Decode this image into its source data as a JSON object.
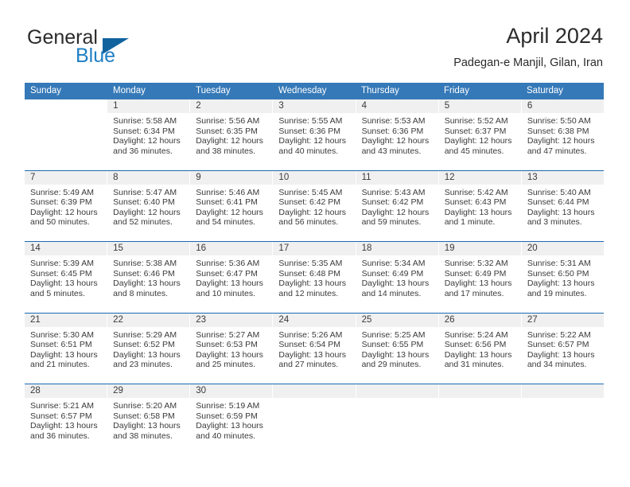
{
  "brand": {
    "name_part1": "General",
    "name_part2": "Blue",
    "logo_icon": "triangle-logo-icon"
  },
  "header": {
    "title": "April 2024",
    "subtitle": "Padegan-e Manjil, Gilan, Iran"
  },
  "colors": {
    "header_blue": "#3579b8",
    "row_separator_blue": "#1b6ab0",
    "date_band_gray": "#f0f0f0",
    "brand_blue": "#1f7fc4",
    "logo_blue": "#11639e",
    "text": "#3a3a3a"
  },
  "weekdays": [
    "Sunday",
    "Monday",
    "Tuesday",
    "Wednesday",
    "Thursday",
    "Friday",
    "Saturday"
  ],
  "labels": {
    "sunrise_prefix": "Sunrise:",
    "sunset_prefix": "Sunset:",
    "daylight_prefix": "Daylight:"
  },
  "weeks": [
    [
      {
        "day": "",
        "empty": true,
        "banded": false,
        "sunrise": "",
        "sunset": "",
        "daylight": ""
      },
      {
        "day": "1",
        "empty": false,
        "banded": true,
        "sunrise": "Sunrise: 5:58 AM",
        "sunset": "Sunset: 6:34 PM",
        "daylight": "Daylight: 12 hours and 36 minutes."
      },
      {
        "day": "2",
        "empty": false,
        "banded": true,
        "sunrise": "Sunrise: 5:56 AM",
        "sunset": "Sunset: 6:35 PM",
        "daylight": "Daylight: 12 hours and 38 minutes."
      },
      {
        "day": "3",
        "empty": false,
        "banded": true,
        "sunrise": "Sunrise: 5:55 AM",
        "sunset": "Sunset: 6:36 PM",
        "daylight": "Daylight: 12 hours and 40 minutes."
      },
      {
        "day": "4",
        "empty": false,
        "banded": true,
        "sunrise": "Sunrise: 5:53 AM",
        "sunset": "Sunset: 6:36 PM",
        "daylight": "Daylight: 12 hours and 43 minutes."
      },
      {
        "day": "5",
        "empty": false,
        "banded": true,
        "sunrise": "Sunrise: 5:52 AM",
        "sunset": "Sunset: 6:37 PM",
        "daylight": "Daylight: 12 hours and 45 minutes."
      },
      {
        "day": "6",
        "empty": false,
        "banded": true,
        "sunrise": "Sunrise: 5:50 AM",
        "sunset": "Sunset: 6:38 PM",
        "daylight": "Daylight: 12 hours and 47 minutes."
      }
    ],
    [
      {
        "day": "7",
        "empty": false,
        "banded": true,
        "sunrise": "Sunrise: 5:49 AM",
        "sunset": "Sunset: 6:39 PM",
        "daylight": "Daylight: 12 hours and 50 minutes."
      },
      {
        "day": "8",
        "empty": false,
        "banded": true,
        "sunrise": "Sunrise: 5:47 AM",
        "sunset": "Sunset: 6:40 PM",
        "daylight": "Daylight: 12 hours and 52 minutes."
      },
      {
        "day": "9",
        "empty": false,
        "banded": true,
        "sunrise": "Sunrise: 5:46 AM",
        "sunset": "Sunset: 6:41 PM",
        "daylight": "Daylight: 12 hours and 54 minutes."
      },
      {
        "day": "10",
        "empty": false,
        "banded": true,
        "sunrise": "Sunrise: 5:45 AM",
        "sunset": "Sunset: 6:42 PM",
        "daylight": "Daylight: 12 hours and 56 minutes."
      },
      {
        "day": "11",
        "empty": false,
        "banded": true,
        "sunrise": "Sunrise: 5:43 AM",
        "sunset": "Sunset: 6:42 PM",
        "daylight": "Daylight: 12 hours and 59 minutes."
      },
      {
        "day": "12",
        "empty": false,
        "banded": true,
        "sunrise": "Sunrise: 5:42 AM",
        "sunset": "Sunset: 6:43 PM",
        "daylight": "Daylight: 13 hours and 1 minute."
      },
      {
        "day": "13",
        "empty": false,
        "banded": true,
        "sunrise": "Sunrise: 5:40 AM",
        "sunset": "Sunset: 6:44 PM",
        "daylight": "Daylight: 13 hours and 3 minutes."
      }
    ],
    [
      {
        "day": "14",
        "empty": false,
        "banded": true,
        "sunrise": "Sunrise: 5:39 AM",
        "sunset": "Sunset: 6:45 PM",
        "daylight": "Daylight: 13 hours and 5 minutes."
      },
      {
        "day": "15",
        "empty": false,
        "banded": true,
        "sunrise": "Sunrise: 5:38 AM",
        "sunset": "Sunset: 6:46 PM",
        "daylight": "Daylight: 13 hours and 8 minutes."
      },
      {
        "day": "16",
        "empty": false,
        "banded": true,
        "sunrise": "Sunrise: 5:36 AM",
        "sunset": "Sunset: 6:47 PM",
        "daylight": "Daylight: 13 hours and 10 minutes."
      },
      {
        "day": "17",
        "empty": false,
        "banded": true,
        "sunrise": "Sunrise: 5:35 AM",
        "sunset": "Sunset: 6:48 PM",
        "daylight": "Daylight: 13 hours and 12 minutes."
      },
      {
        "day": "18",
        "empty": false,
        "banded": true,
        "sunrise": "Sunrise: 5:34 AM",
        "sunset": "Sunset: 6:49 PM",
        "daylight": "Daylight: 13 hours and 14 minutes."
      },
      {
        "day": "19",
        "empty": false,
        "banded": true,
        "sunrise": "Sunrise: 5:32 AM",
        "sunset": "Sunset: 6:49 PM",
        "daylight": "Daylight: 13 hours and 17 minutes."
      },
      {
        "day": "20",
        "empty": false,
        "banded": true,
        "sunrise": "Sunrise: 5:31 AM",
        "sunset": "Sunset: 6:50 PM",
        "daylight": "Daylight: 13 hours and 19 minutes."
      }
    ],
    [
      {
        "day": "21",
        "empty": false,
        "banded": true,
        "sunrise": "Sunrise: 5:30 AM",
        "sunset": "Sunset: 6:51 PM",
        "daylight": "Daylight: 13 hours and 21 minutes."
      },
      {
        "day": "22",
        "empty": false,
        "banded": true,
        "sunrise": "Sunrise: 5:29 AM",
        "sunset": "Sunset: 6:52 PM",
        "daylight": "Daylight: 13 hours and 23 minutes."
      },
      {
        "day": "23",
        "empty": false,
        "banded": true,
        "sunrise": "Sunrise: 5:27 AM",
        "sunset": "Sunset: 6:53 PM",
        "daylight": "Daylight: 13 hours and 25 minutes."
      },
      {
        "day": "24",
        "empty": false,
        "banded": true,
        "sunrise": "Sunrise: 5:26 AM",
        "sunset": "Sunset: 6:54 PM",
        "daylight": "Daylight: 13 hours and 27 minutes."
      },
      {
        "day": "25",
        "empty": false,
        "banded": true,
        "sunrise": "Sunrise: 5:25 AM",
        "sunset": "Sunset: 6:55 PM",
        "daylight": "Daylight: 13 hours and 29 minutes."
      },
      {
        "day": "26",
        "empty": false,
        "banded": true,
        "sunrise": "Sunrise: 5:24 AM",
        "sunset": "Sunset: 6:56 PM",
        "daylight": "Daylight: 13 hours and 31 minutes."
      },
      {
        "day": "27",
        "empty": false,
        "banded": true,
        "sunrise": "Sunrise: 5:22 AM",
        "sunset": "Sunset: 6:57 PM",
        "daylight": "Daylight: 13 hours and 34 minutes."
      }
    ],
    [
      {
        "day": "28",
        "empty": false,
        "banded": true,
        "sunrise": "Sunrise: 5:21 AM",
        "sunset": "Sunset: 6:57 PM",
        "daylight": "Daylight: 13 hours and 36 minutes."
      },
      {
        "day": "29",
        "empty": false,
        "banded": true,
        "sunrise": "Sunrise: 5:20 AM",
        "sunset": "Sunset: 6:58 PM",
        "daylight": "Daylight: 13 hours and 38 minutes."
      },
      {
        "day": "30",
        "empty": false,
        "banded": true,
        "sunrise": "Sunrise: 5:19 AM",
        "sunset": "Sunset: 6:59 PM",
        "daylight": "Daylight: 13 hours and 40 minutes."
      },
      {
        "day": "",
        "empty": true,
        "banded": true,
        "sunrise": "",
        "sunset": "",
        "daylight": ""
      },
      {
        "day": "",
        "empty": true,
        "banded": true,
        "sunrise": "",
        "sunset": "",
        "daylight": ""
      },
      {
        "day": "",
        "empty": true,
        "banded": true,
        "sunrise": "",
        "sunset": "",
        "daylight": ""
      },
      {
        "day": "",
        "empty": true,
        "banded": true,
        "sunrise": "",
        "sunset": "",
        "daylight": ""
      }
    ]
  ]
}
